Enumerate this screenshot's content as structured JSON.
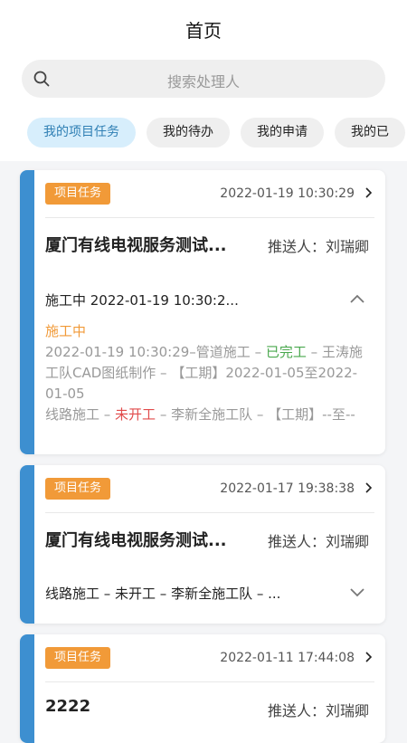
{
  "header": {
    "title": "首页"
  },
  "search": {
    "placeholder": "搜索处理人"
  },
  "tabs": [
    {
      "label": "我的项目任务"
    },
    {
      "label": "我的待办"
    },
    {
      "label": "我的申请"
    },
    {
      "label": "我的已"
    }
  ],
  "cards": [
    {
      "badge": "项目任务",
      "time": "2022-01-19 10:30:29",
      "title": "厦门有线电视服务测试...",
      "pusher": "推送人：刘瑞卿",
      "section": "施工中 2022-01-19 10:30:2...",
      "detail": {
        "status": "施工中",
        "line1_pre": "2022-01-19 10:30:29–管道施工 – ",
        "line1_status": "已完工",
        "line1_post": " – 王涛施工队CAD图纸制作 – 【工期】2022-01-05至2022-01-05",
        "line2_pre": "线路施工 – ",
        "line2_status": "未开工",
        "line2_post": " – 李新全施工队 – 【工期】--至--"
      }
    },
    {
      "badge": "项目任务",
      "time": "2022-01-17 19:38:38",
      "title": "厦门有线电视服务测试...",
      "pusher": "推送人：刘瑞卿",
      "section": "线路施工 – 未开工 – 李新全施工队 – ..."
    },
    {
      "badge": "项目任务",
      "time": "2022-01-11 17:44:08",
      "title": "2222",
      "pusher": "推送人：刘瑞卿"
    }
  ],
  "colors": {
    "accent": "#3d8fd0",
    "badge": "#f19a38",
    "done": "#4aa84e",
    "notStarted": "#e14b4b"
  }
}
